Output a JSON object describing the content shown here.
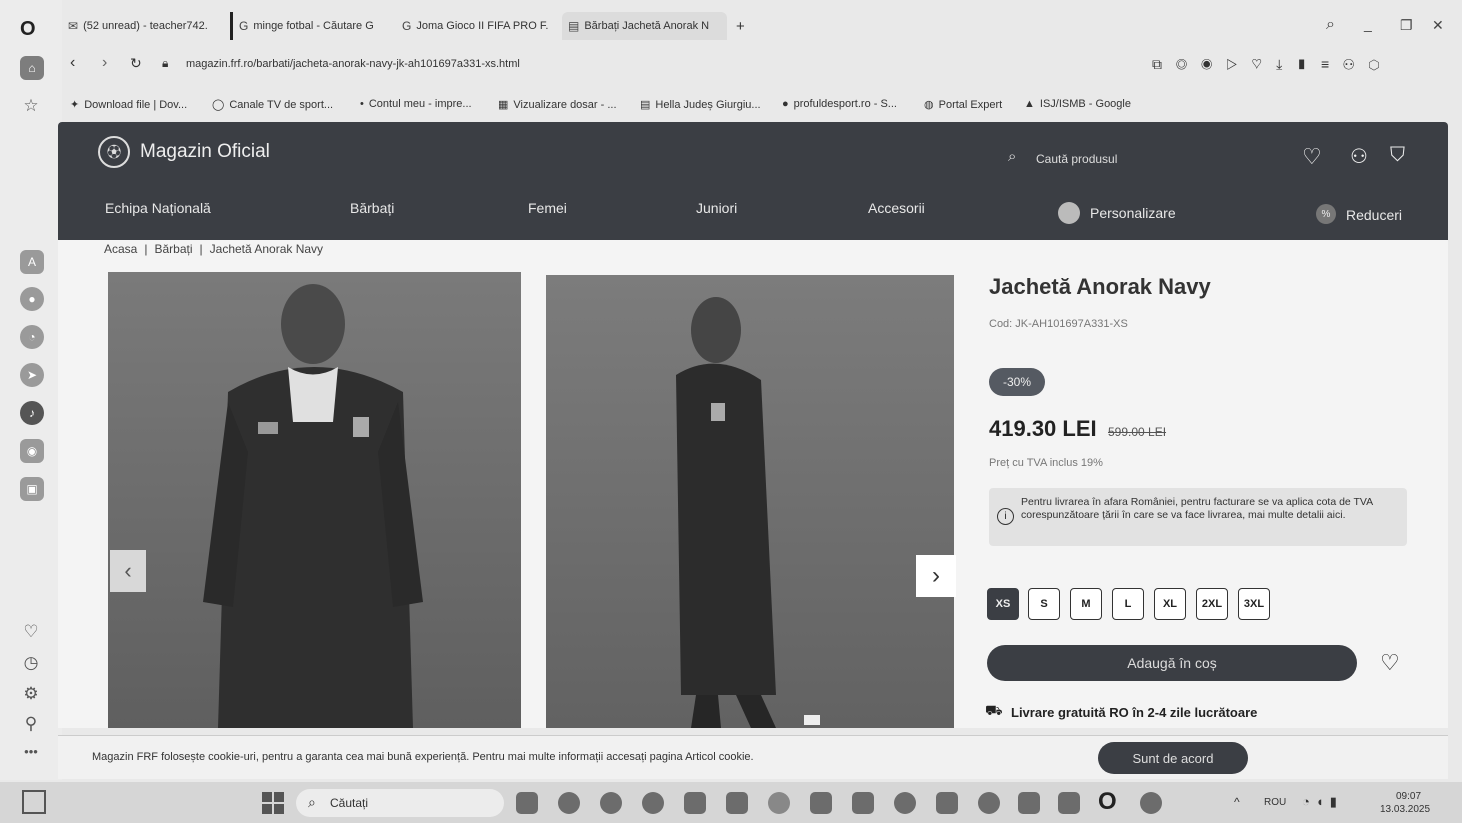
{
  "browser": {
    "tabs": [
      {
        "label": "(52 unread) - teacher742.",
        "icon": "mail-icon"
      },
      {
        "label": "minge fotbal - Căutare G",
        "icon": "google-icon"
      },
      {
        "label": "Joma Gioco II FIFA PRO F.",
        "icon": "google-icon"
      },
      {
        "label": "Bărbați Jachetă Anorak N",
        "icon": "shop-icon"
      }
    ],
    "new_tab": "+",
    "window_controls": {
      "search": "⌕",
      "minimize": "_",
      "restore": "❐",
      "close": "✕"
    },
    "url": "magazin.frf.ro/barbati/jacheta-anorak-navy-jk-ah101697a331-xs.html",
    "bookmarks": [
      "Download file | Dov...",
      "Canale TV de sport...",
      "Contul meu - impre...",
      "Vizualizare dosar - ...",
      "Hella Judeș Giurgiu...",
      "profuldesport.ro - S...",
      "Portal Expert",
      "ISJ/ISMB - Google"
    ]
  },
  "site": {
    "logo_text": "Magazin Oficial",
    "search_placeholder": "Caută produsul",
    "nav": [
      "Echipa Națională",
      "Bărbați",
      "Femei",
      "Juniori",
      "Accesorii",
      "Personalizare",
      "Reduceri"
    ],
    "breadcrumb": [
      "Acasa",
      "Bărbați",
      "Jachetă Anorak Navy"
    ],
    "breadcrumb_sep": "|"
  },
  "product": {
    "title": "Jachetă Anorak Navy",
    "code": "Cod: JK-AH101697A331-XS",
    "discount": "-30%",
    "price": "419.30 LEI",
    "old_price": "599.00 LEI",
    "vat_note": "Preț cu TVA inclus 19%",
    "info_note": "Pentru livrarea în afara României, pentru facturare se va aplica cota de TVA corespunzătoare țării în care se va face livrarea, mai multe detalii aici.",
    "sizes": [
      "XS",
      "S",
      "M",
      "L",
      "XL",
      "2XL",
      "3XL"
    ],
    "selected_size": "XS",
    "add_to_cart": "Adaugă în coș",
    "shipping": "Livrare gratuită RO în 2-4 zile lucrătoare",
    "prev_arrow": "‹",
    "next_arrow": "›"
  },
  "cookie": {
    "text": "Magazin FRF folosește cookie-uri, pentru a garanta cea mai bună experiență. Pentru mai multe informații accesați pagina Articol cookie.",
    "accept": "Sunt de acord"
  },
  "taskbar": {
    "search_label": "Căutați",
    "lang": "ROU",
    "time": "09:07",
    "date": "13.03.2025"
  },
  "colors": {
    "header_bg": "#3b3e44",
    "accent_dark": "#3b3e44",
    "discount_badge": "#555a62"
  }
}
